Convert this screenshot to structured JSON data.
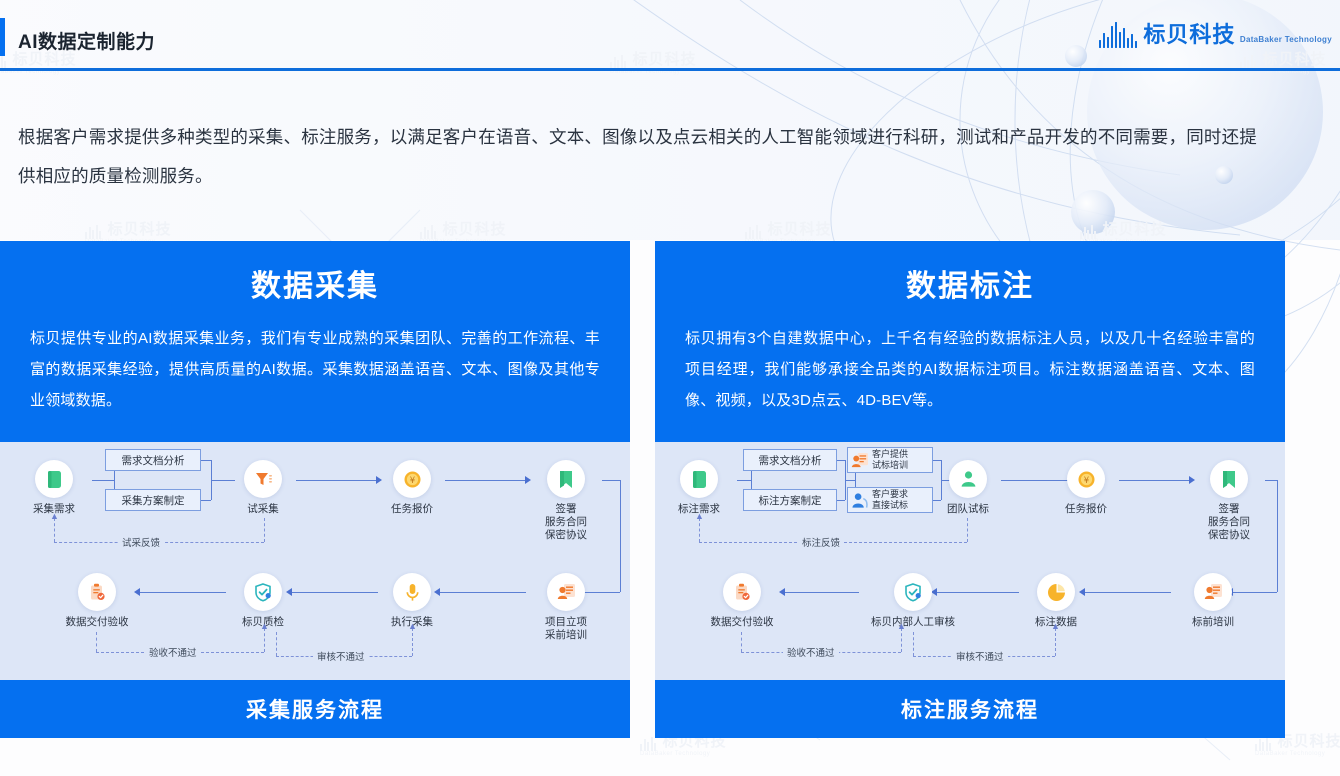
{
  "header": {
    "title": "AI数据定制能力",
    "logo_cn": "标贝科技",
    "logo_en": "DataBaker Technology",
    "accent_color": "#0570f0"
  },
  "intro": "根据客户需求提供多种类型的采集、标注服务，以满足客户在语音、文本、图像以及点云相关的人工智能领域进行科研，测试和产品开发的不同需要，同时还提供相应的质量检测服务。",
  "cards": [
    {
      "id": "collection",
      "title": "数据采集",
      "description": "标贝提供专业的AI数据采集业务，我们有专业成熟的采集团队、完善的工作流程、丰富的数据采集经验，提供高质量的AI数据。采集数据涵盖语音、文本、图像及其他专业领域数据。",
      "footer": "采集服务流程",
      "flow": {
        "top_nodes": [
          {
            "label": "采集需求",
            "icon": "green-book-icon"
          },
          {
            "label": "试采集",
            "icon": "orange-funnel-icon"
          },
          {
            "label": "任务报价",
            "icon": "yen-coin-icon"
          },
          {
            "label": "签署\n服务合同\n保密协议",
            "icon": "green-bookmark-icon"
          }
        ],
        "process_boxes": [
          {
            "label": "需求文档分析"
          },
          {
            "label": "采集方案制定"
          }
        ],
        "bottom_nodes": [
          {
            "label": "数据交付验收",
            "icon": "orange-clipboard-check-icon"
          },
          {
            "label": "标贝质检",
            "icon": "teal-shield-check-icon"
          },
          {
            "label": "执行采集",
            "icon": "yellow-microphone-icon"
          },
          {
            "label": "项目立项\n采前培训",
            "icon": "orange-training-icon"
          }
        ],
        "feedback_labels": [
          {
            "label": "试采反馈"
          },
          {
            "label": "验收不通过"
          },
          {
            "label": "审核不通过"
          }
        ]
      }
    },
    {
      "id": "annotation",
      "title": "数据标注",
      "description": "标贝拥有3个自建数据中心，上千名有经验的数据标注人员，以及几十名经验丰富的项目经理，我们能够承接全品类的AI数据标注项目。标注数据涵盖语音、文本、图像、视频，以及3D点云、4D-BEV等。",
      "footer": "标注服务流程",
      "flow": {
        "top_nodes": [
          {
            "label": "标注需求",
            "icon": "green-book-icon"
          },
          {
            "label": "团队试标",
            "icon": "green-person-icon"
          },
          {
            "label": "任务报价",
            "icon": "yen-coin-icon"
          },
          {
            "label": "签署\n服务合同\n保密协议",
            "icon": "green-bookmark-icon"
          }
        ],
        "process_boxes": [
          {
            "label": "需求文档分析"
          },
          {
            "label": "标注方案制定"
          }
        ],
        "option_boxes": [
          {
            "line1": "客户提供",
            "line2": "试标培训",
            "icon": "orange-training-icon"
          },
          {
            "line1": "客户要求",
            "line2": "直接试标",
            "icon": "blue-person-icon"
          }
        ],
        "bottom_nodes": [
          {
            "label": "数据交付验收",
            "icon": "orange-clipboard-check-icon"
          },
          {
            "label": "标贝内部人工审核",
            "icon": "teal-shield-check-icon"
          },
          {
            "label": "标注数据",
            "icon": "yellow-pie-icon"
          },
          {
            "label": "标前培训",
            "icon": "orange-training-icon"
          }
        ],
        "feedback_labels": [
          {
            "label": "标注反馈"
          },
          {
            "label": "验收不通过"
          },
          {
            "label": "审核不通过"
          }
        ]
      }
    }
  ],
  "watermark": {
    "cn": "标贝科技",
    "en": "DataBaker Technology"
  }
}
